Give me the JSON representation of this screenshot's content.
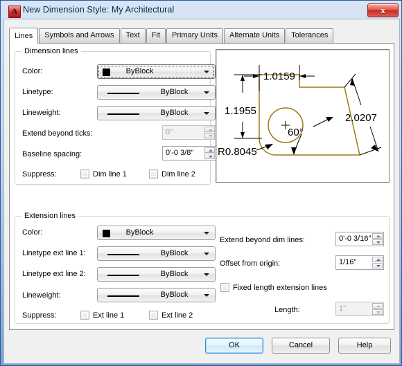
{
  "window": {
    "title": "New Dimension Style: My Architectural",
    "app_icon": "autocad-icon",
    "app_icon_glyph": "A",
    "close_label": "x"
  },
  "tabs": [
    {
      "label": "Lines",
      "active": true
    },
    {
      "label": "Symbols and Arrows",
      "active": false
    },
    {
      "label": "Text",
      "active": false
    },
    {
      "label": "Fit",
      "active": false
    },
    {
      "label": "Primary Units",
      "active": false
    },
    {
      "label": "Alternate Units",
      "active": false
    },
    {
      "label": "Tolerances",
      "active": false
    }
  ],
  "dimension_lines": {
    "group_label": "Dimension lines",
    "color_label": "Color:",
    "color_value": "ByBlock",
    "linetype_label": "Linetype:",
    "linetype_value": "ByBlock",
    "lineweight_label": "Lineweight:",
    "lineweight_value": "ByBlock",
    "extend_beyond_ticks_label": "Extend beyond ticks:",
    "extend_beyond_ticks_value": "0\"",
    "baseline_spacing_label": "Baseline spacing:",
    "baseline_spacing_value": "0'-0 3/8\"",
    "suppress_label": "Suppress:",
    "suppress_1_label": "Dim line 1",
    "suppress_2_label": "Dim line 2"
  },
  "extension_lines": {
    "group_label": "Extension lines",
    "color_label": "Color:",
    "color_value": "ByBlock",
    "linetype_ext1_label": "Linetype ext line 1:",
    "linetype_ext1_value": "ByBlock",
    "linetype_ext2_label": "Linetype ext line 2:",
    "linetype_ext2_value": "ByBlock",
    "lineweight_label": "Lineweight:",
    "lineweight_value": "ByBlock",
    "suppress_label": "Suppress:",
    "suppress_1_label": "Ext line 1",
    "suppress_2_label": "Ext line 2",
    "extend_beyond_dim_label": "Extend beyond dim lines:",
    "extend_beyond_dim_value": "0'-0 3/16\"",
    "offset_from_origin_label": "Offset from origin:",
    "offset_from_origin_value": "1/16\"",
    "fixed_length_label": "Fixed length extension lines",
    "length_label": "Length:",
    "length_value": "1\""
  },
  "preview": {
    "dim_horizontal": "1.0159",
    "dim_vertical": "1.1955",
    "dim_angled": "2.0207",
    "dim_angle": "60°",
    "dim_radius": "R0.8045",
    "geometry_color": "#9b7a16",
    "annotation_color": "#000000"
  },
  "footer": {
    "ok_label": "OK",
    "cancel_label": "Cancel",
    "help_label": "Help"
  }
}
